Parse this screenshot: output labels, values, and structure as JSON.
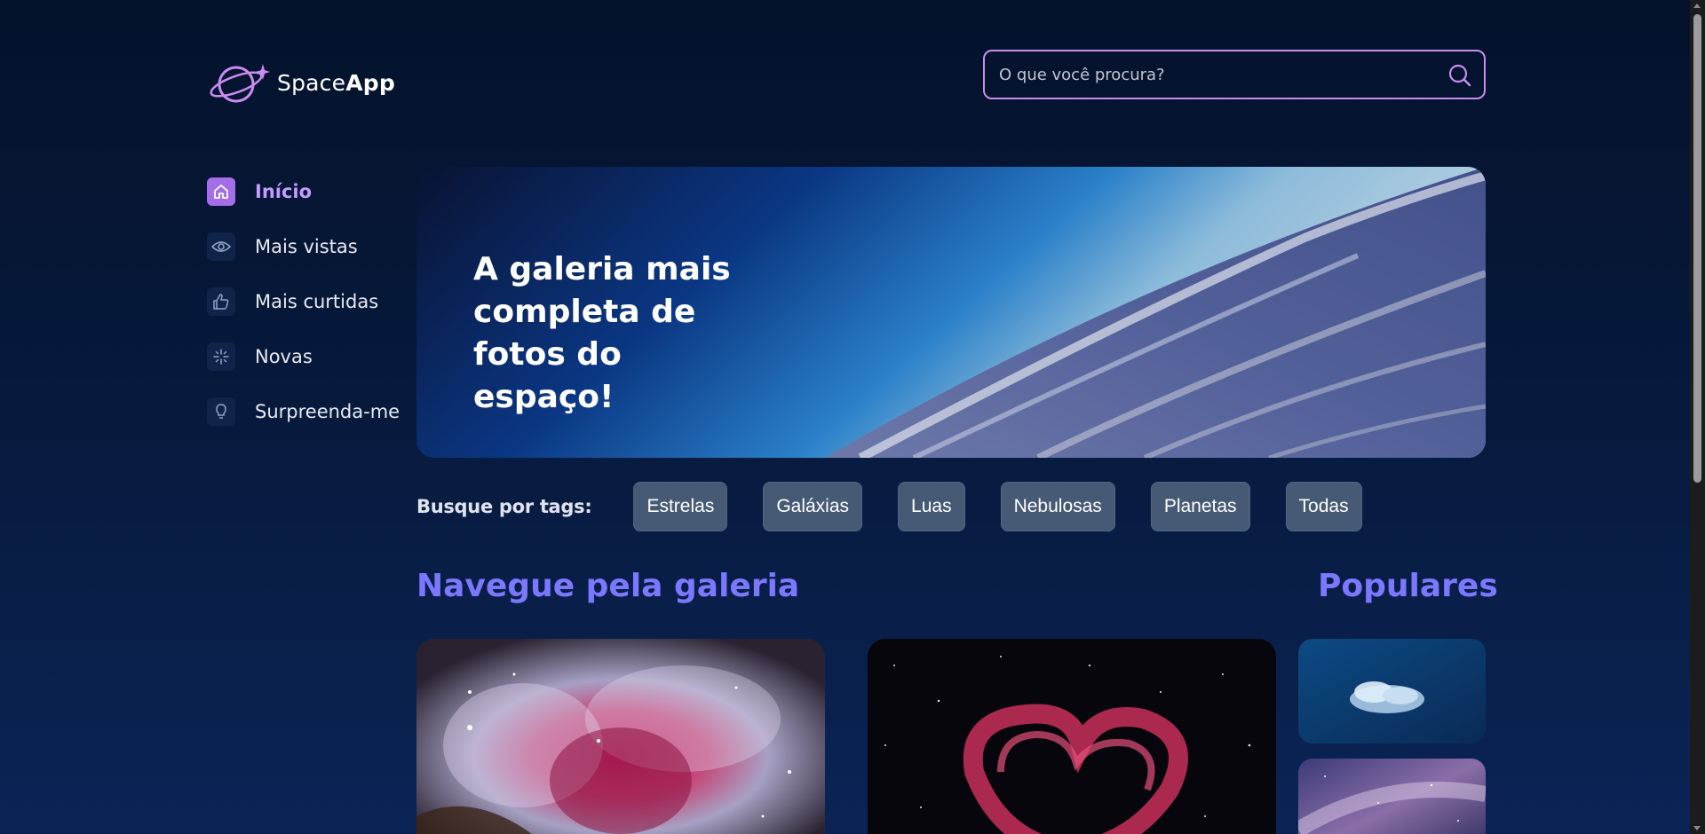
{
  "app": {
    "logo_text_light": "Space",
    "logo_text_bold": "App"
  },
  "search": {
    "placeholder": "O que você procura?"
  },
  "sidebar": {
    "items": [
      {
        "label": "Início",
        "icon": "home-icon",
        "active": true
      },
      {
        "label": "Mais vistas",
        "icon": "eye-icon",
        "active": false
      },
      {
        "label": "Mais curtidas",
        "icon": "thumbs-up-icon",
        "active": false
      },
      {
        "label": "Novas",
        "icon": "sparkle-icon",
        "active": false
      },
      {
        "label": "Surpreenda-me",
        "icon": "lightbulb-icon",
        "active": false
      }
    ]
  },
  "banner": {
    "title": "A galeria mais completa de fotos do espaço!"
  },
  "tags": {
    "label": "Busque por tags:",
    "items": [
      "Estrelas",
      "Galáxias",
      "Luas",
      "Nebulosas",
      "Planetas",
      "Todas"
    ]
  },
  "gallery": {
    "title": "Navegue pela galeria"
  },
  "popular": {
    "title": "Populares"
  },
  "colors": {
    "accent": "#c98cf1",
    "active_nav": "#c49bff",
    "section_title": "#7b78ff",
    "tag_bg": "#465a76"
  }
}
